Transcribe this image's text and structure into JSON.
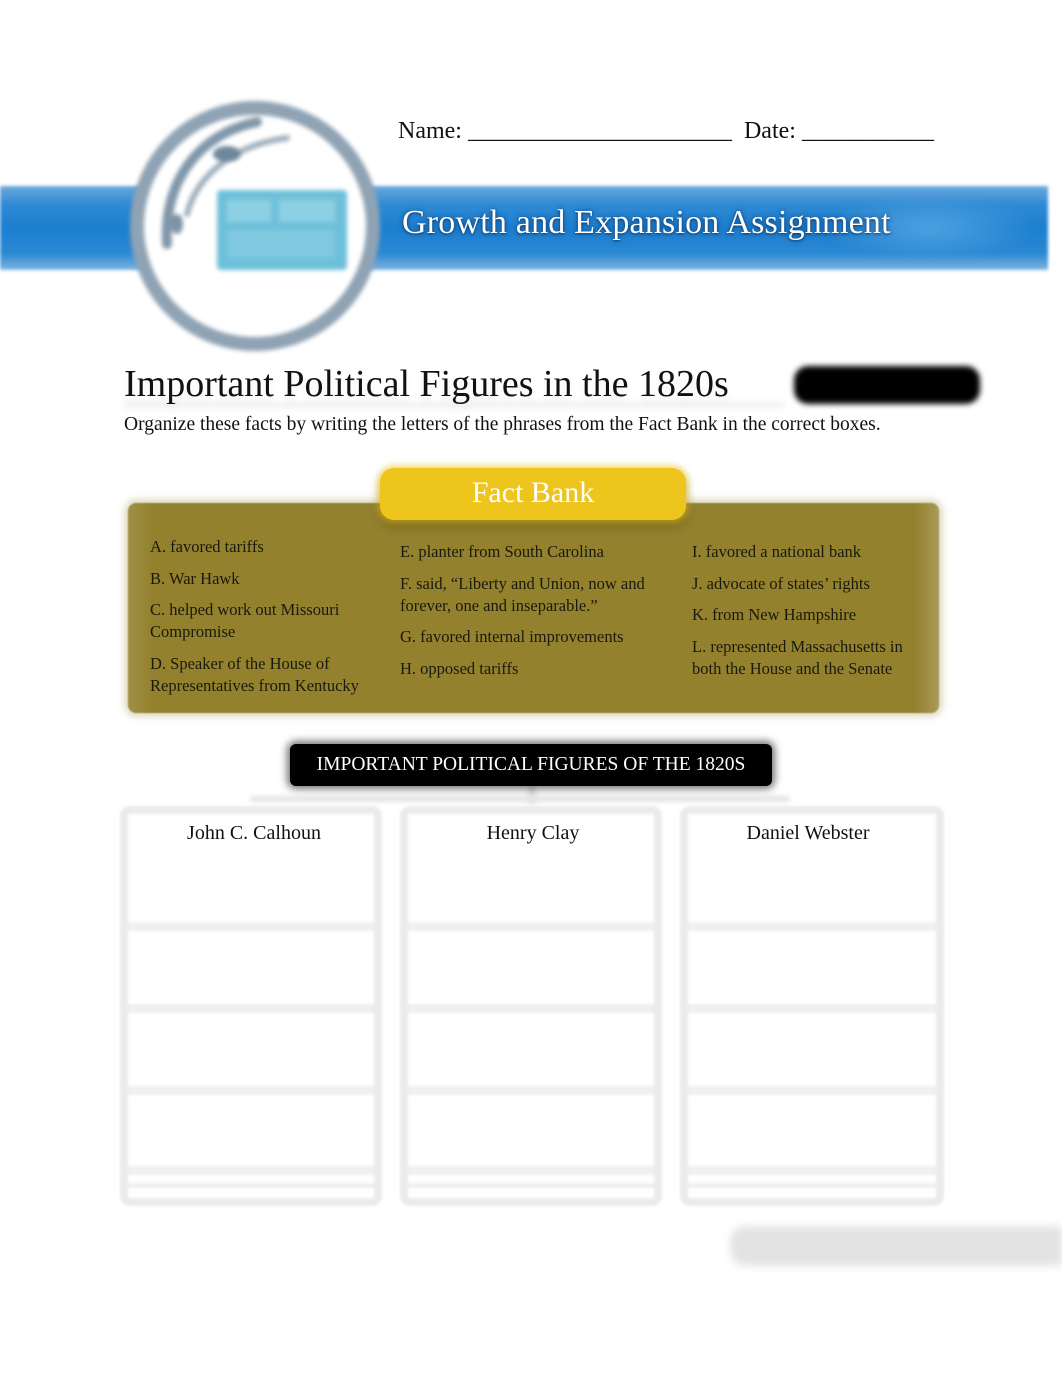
{
  "header": {
    "name_label": "Name: ______________________  Date: ___________",
    "banner_title": "Growth and Expansion Assignment",
    "brand_colors": {
      "banner": "#1c7fd0",
      "logo_ring": "#8fa3b4"
    }
  },
  "main": {
    "title": "Important Political Figures in the 1820s",
    "instructions": "Organize these facts by writing the letters of the phrases from the Fact Bank in the correct boxes."
  },
  "fact_bank": {
    "label": "Fact Bank",
    "colors": {
      "panel": "#93812e",
      "pill": "#eec51c"
    },
    "columns": [
      [
        "A. favored tariffs",
        "B. War Hawk",
        "C. helped work out Missouri Compromise",
        "D. Speaker of the House of Representatives from Kentucky"
      ],
      [
        "E. planter from South Carolina",
        "F. said, “Liberty and Union, now and forever, one and inseparable.”",
        "G. favored internal improvements",
        "H. opposed tariffs"
      ],
      [
        "I. favored a national bank",
        "J. advocate of states’ rights",
        "K. from New Hampshire",
        "L. represented Massachusetts in both the House and the Senate"
      ]
    ]
  },
  "chart": {
    "heading": "IMPORTANT POLITICAL FIGURES OF THE 1820S",
    "figures": [
      "John C. Calhoun",
      "Henry Clay",
      "Daniel Webster"
    ]
  }
}
